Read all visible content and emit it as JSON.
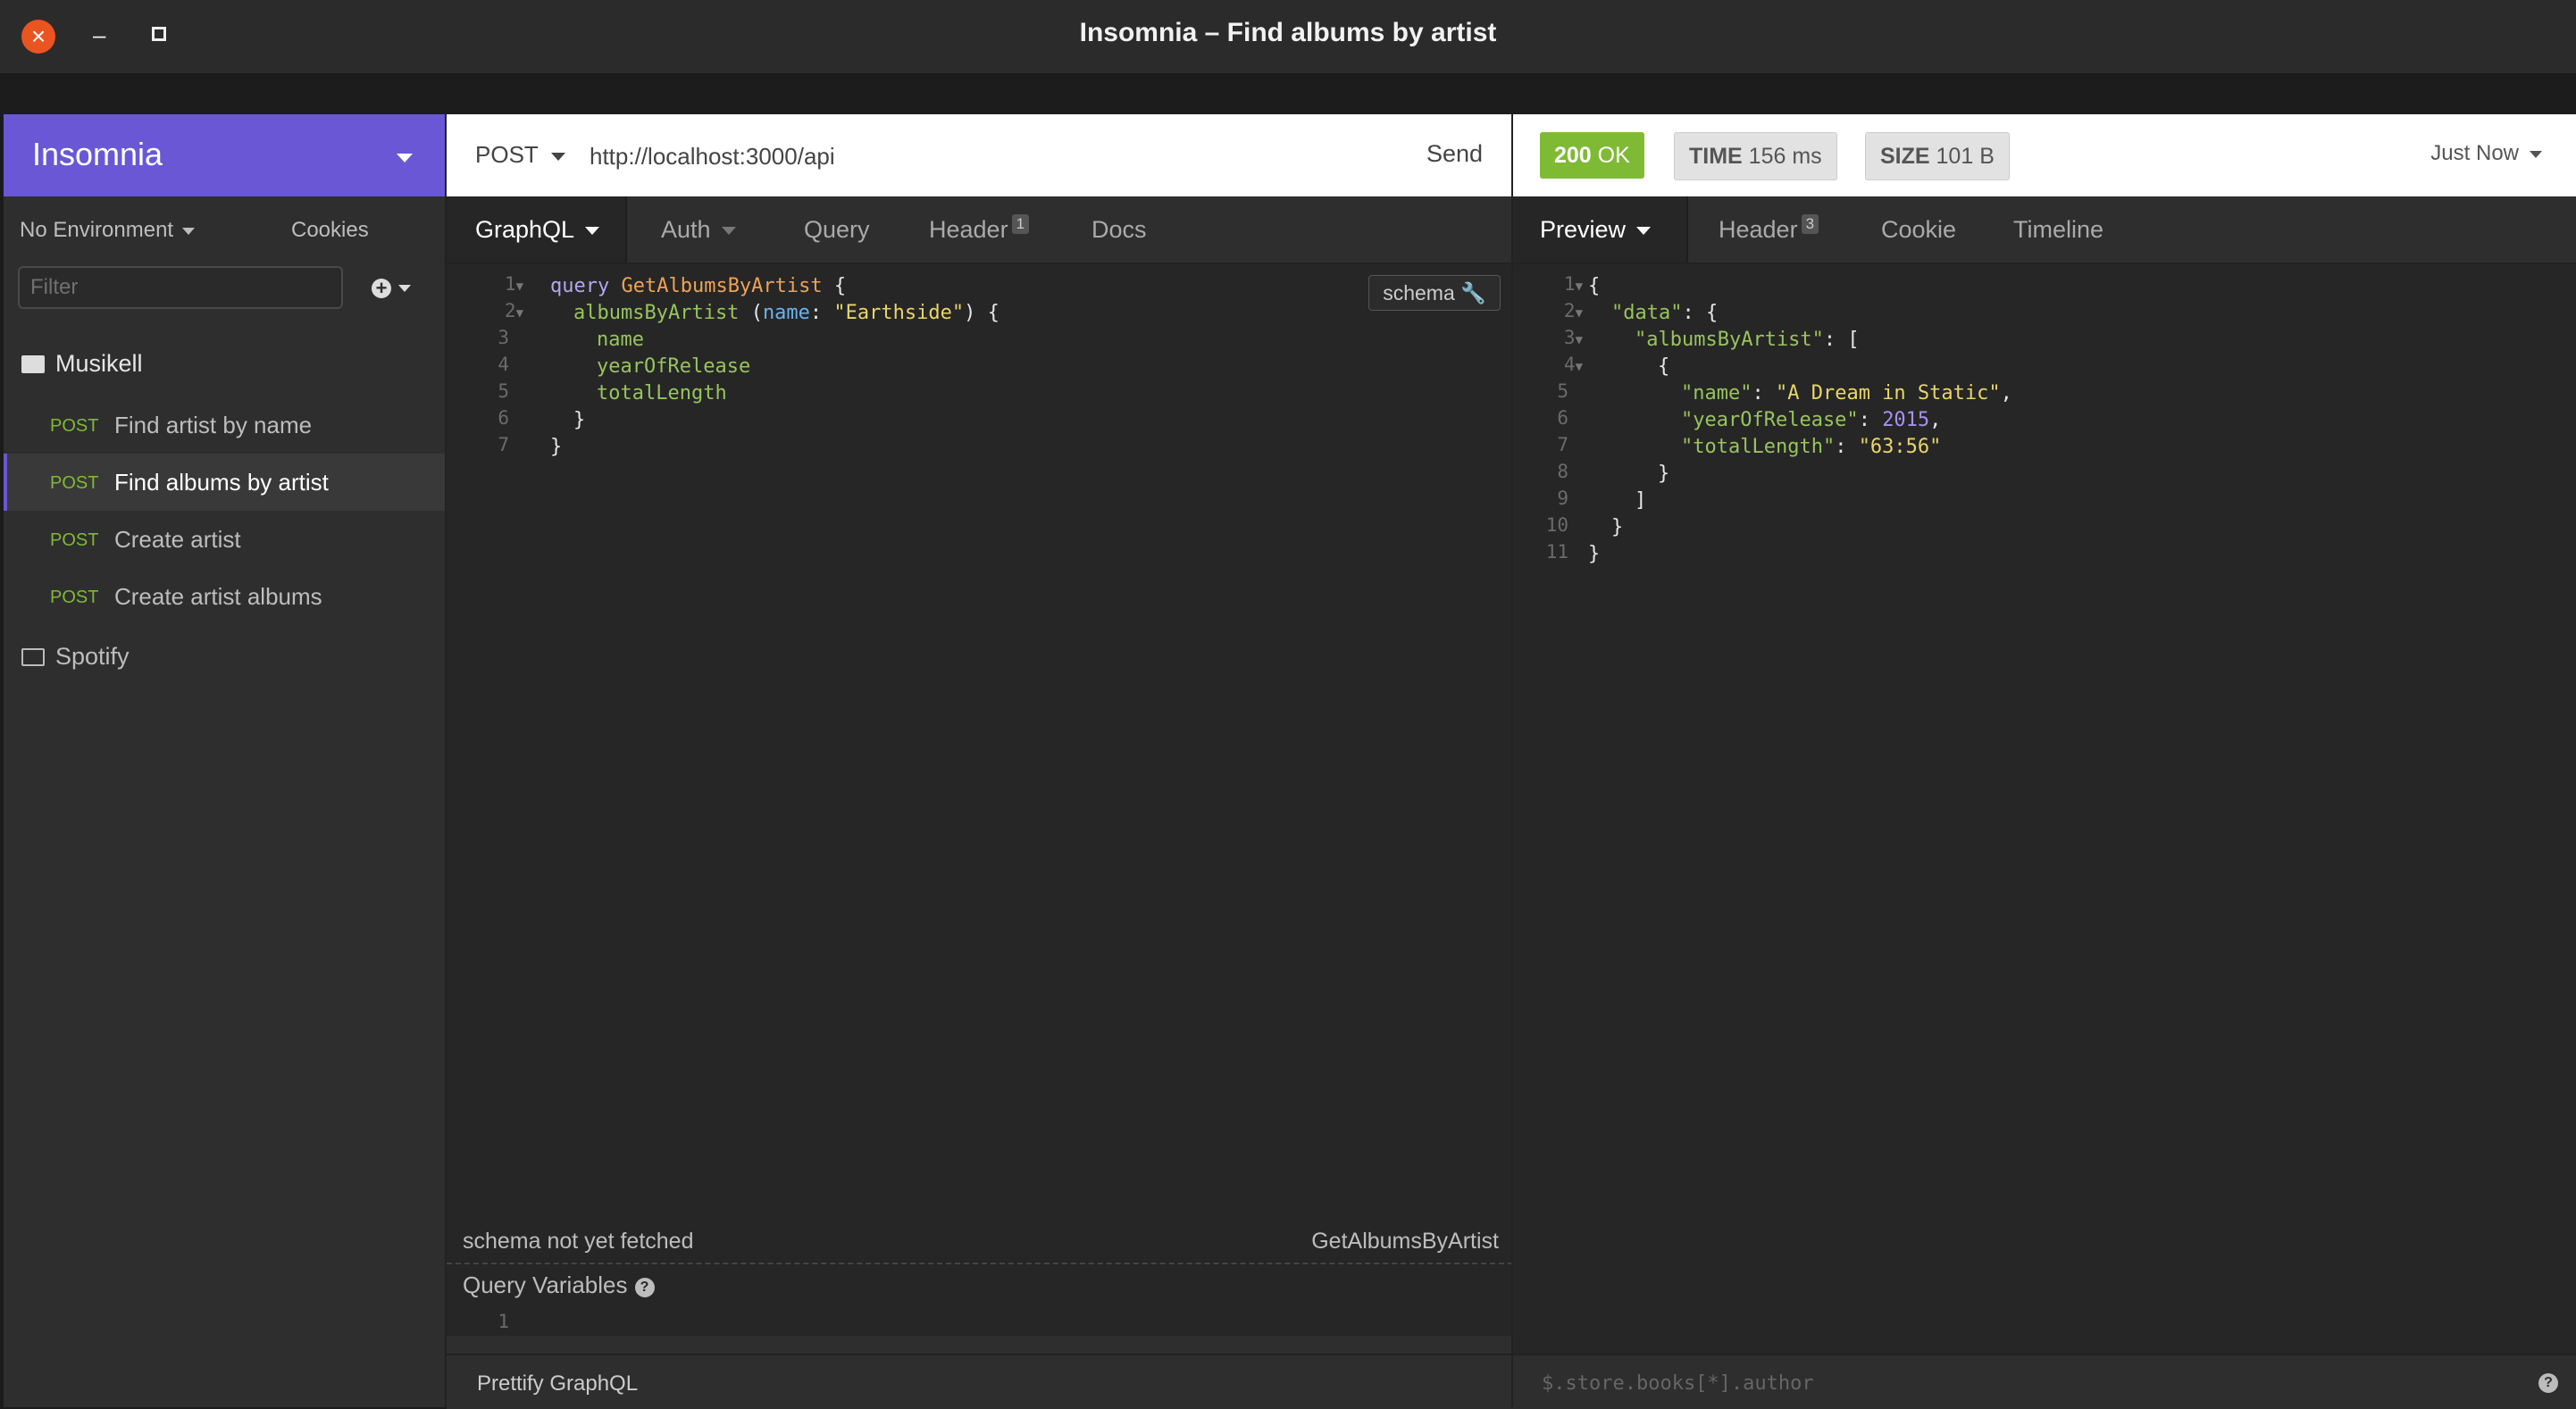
{
  "window": {
    "title": "Insomnia – Find albums by artist",
    "controls": {
      "minimize": "–",
      "close": "×"
    }
  },
  "sidebar": {
    "brand": "Insomnia",
    "environment": "No Environment",
    "cookies": "Cookies",
    "filter_placeholder": "Filter",
    "add_symbol": "+",
    "folders": [
      {
        "name": "Musikell",
        "open": true,
        "requests": [
          {
            "method": "POST",
            "name": "Find artist by name"
          },
          {
            "method": "POST",
            "name": "Find albums by artist",
            "active": true
          },
          {
            "method": "POST",
            "name": "Create artist"
          },
          {
            "method": "POST",
            "name": "Create artist albums"
          }
        ]
      },
      {
        "name": "Spotify",
        "open": false
      }
    ]
  },
  "request": {
    "method": "POST",
    "url": "http://localhost:3000/api",
    "send_label": "Send",
    "tabs": [
      {
        "label": "GraphQL",
        "active": true
      },
      {
        "label": "Auth"
      },
      {
        "label": "Query"
      },
      {
        "label": "Header",
        "badge": "1"
      },
      {
        "label": "Docs"
      }
    ],
    "schema_button": "schema",
    "code_lines": [
      "1",
      "2",
      "3",
      "4",
      "5",
      "6",
      "7"
    ],
    "code": {
      "l1_kw": "query",
      "l1_op": "GetAlbumsByArtist",
      "l1_brace": "{",
      "l2_field": "albumsByArtist",
      "l2_open": "(",
      "l2_arg": "name",
      "l2_colon": ":",
      "l2_str": "\"Earthside\"",
      "l2_close": ") {",
      "l3": "name",
      "l4": "yearOfRelease",
      "l5": "totalLength",
      "l6": "}",
      "l7": "}"
    },
    "schema_status": "schema not yet fetched",
    "operation_name": "GetAlbumsByArtist",
    "query_variables_label": "Query Variables",
    "query_variables_line": "1",
    "prettify_label": "Prettify GraphQL"
  },
  "response": {
    "status": {
      "code": "200",
      "text": "OK"
    },
    "time": {
      "label": "TIME",
      "value": "156 ms"
    },
    "size": {
      "label": "SIZE",
      "value": "101 B"
    },
    "history": "Just Now",
    "tabs": [
      {
        "label": "Preview",
        "active": true
      },
      {
        "label": "Header",
        "badge": "3"
      },
      {
        "label": "Cookie"
      },
      {
        "label": "Timeline"
      }
    ],
    "line_numbers": [
      "1",
      "2",
      "3",
      "4",
      "5",
      "6",
      "7",
      "8",
      "9",
      "10",
      "11"
    ],
    "json": {
      "l1": "{",
      "l2_key": "\"data\"",
      "l2_rest": ": {",
      "l3_key": "\"albumsByArtist\"",
      "l3_rest": ": [",
      "l4": "{",
      "l5_key": "\"name\"",
      "l5_val": "\"A Dream in Static\"",
      "l6_key": "\"yearOfRelease\"",
      "l6_val": "2015",
      "l7_key": "\"totalLength\"",
      "l7_val": "\"63:56\"",
      "l8": "}",
      "l9": "]",
      "l10": "}",
      "l11": "}",
      "colon": ": ",
      "comma": ","
    },
    "filter_placeholder": "$.store.books[*].author",
    "help_symbol": "?"
  },
  "colors": {
    "brand": "#6a57d5",
    "status_ok": "#7fba35",
    "close_button": "#e95420"
  }
}
